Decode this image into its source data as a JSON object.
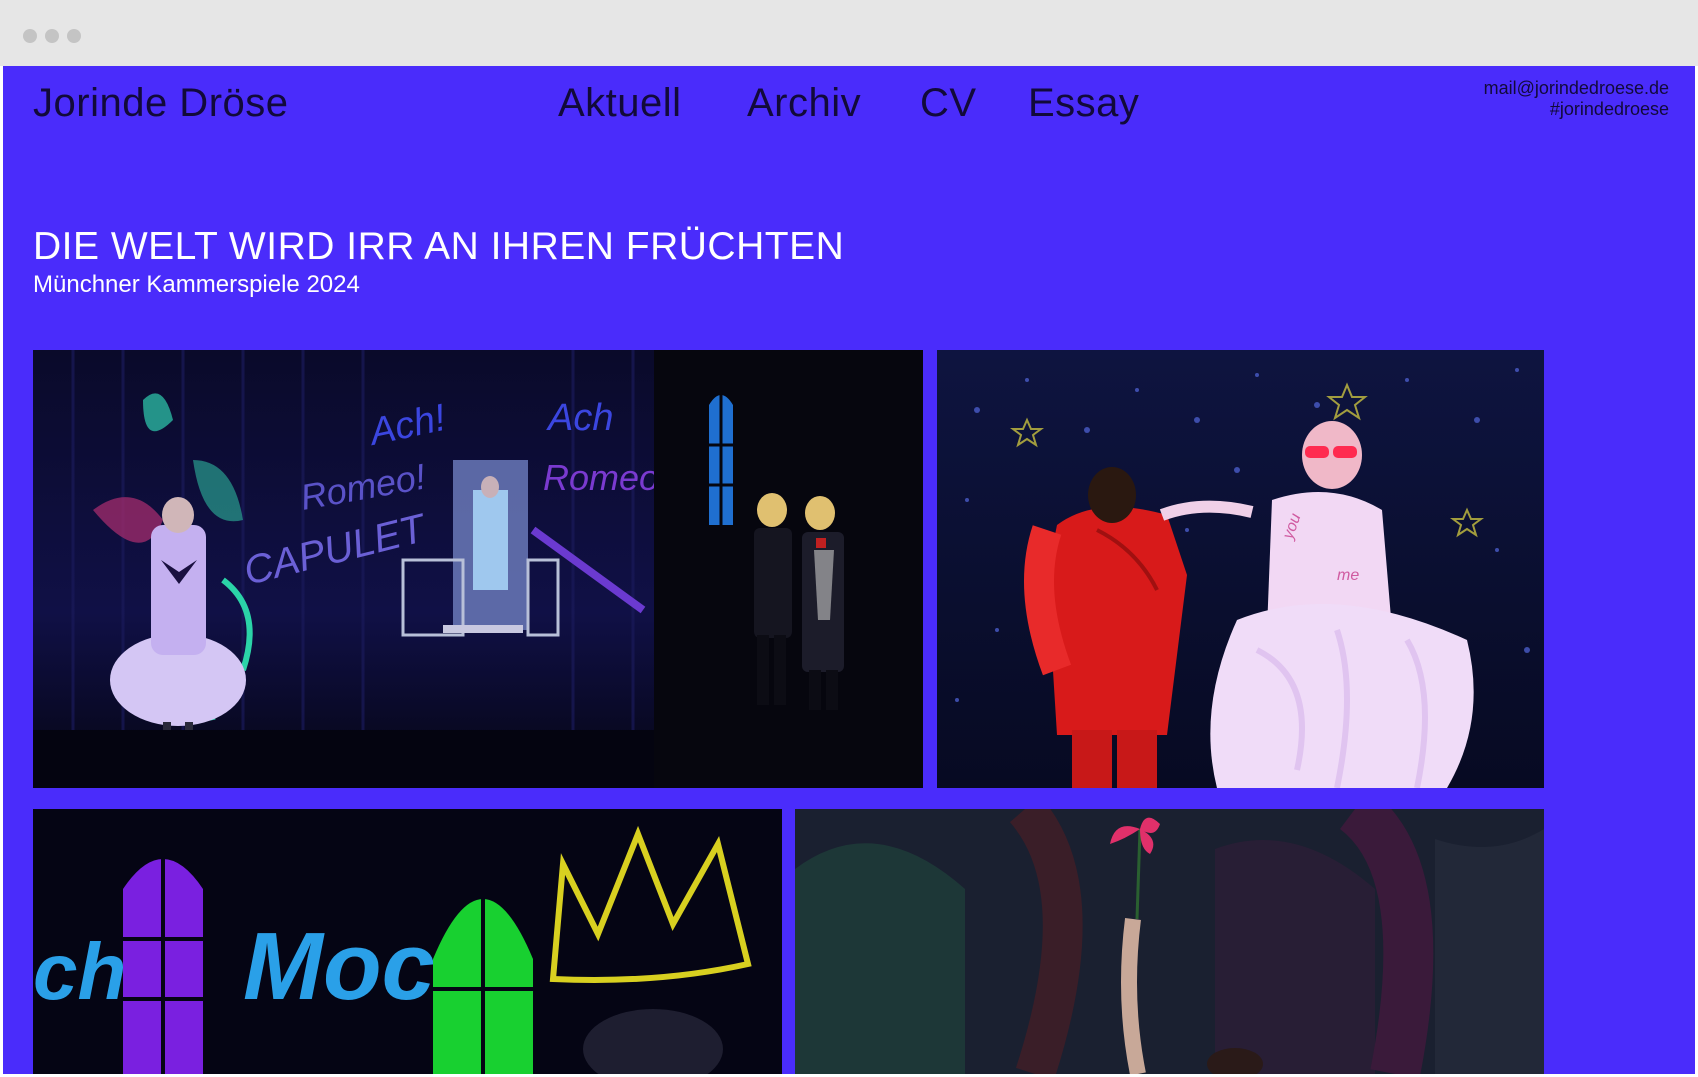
{
  "theme": {
    "background": "#4a2cfb",
    "text_dark": "#120a3a",
    "text_light": "#ffffff"
  },
  "window": {
    "controls": [
      "close-dot",
      "minimize-dot",
      "zoom-dot"
    ]
  },
  "header": {
    "brand": "Jorinde Dröse",
    "nav": [
      {
        "label": "Aktuell"
      },
      {
        "label": "Archiv"
      },
      {
        "label": "CV"
      },
      {
        "label": "Essay"
      }
    ],
    "contact": {
      "email": "mail@jorindedroese.de",
      "hashtag": "#jorindedroese"
    }
  },
  "production": {
    "title": "DIE WELT WIRD IRR AN IHREN FRÜCHTEN",
    "subtitle": "Münchner Kammerspiele 2024"
  },
  "gallery": {
    "photos": [
      {
        "scene": "figure-in-white-dress-before-painted-curtain",
        "graffiti": [
          "Ach!",
          "Romeo!",
          "CAPULET",
          "Ach",
          "Romeo?"
        ]
      },
      {
        "scene": "two-figures-in-black-coats"
      },
      {
        "scene": "figure-in-red-suit-and-figure-in-tulle-dress",
        "shirt_text": [
          "you",
          "me"
        ]
      },
      {
        "scene": "projected-windows-and-crown",
        "graffiti": [
          "ch",
          "Moch"
        ]
      },
      {
        "scene": "raised-arm-with-flower"
      }
    ]
  }
}
